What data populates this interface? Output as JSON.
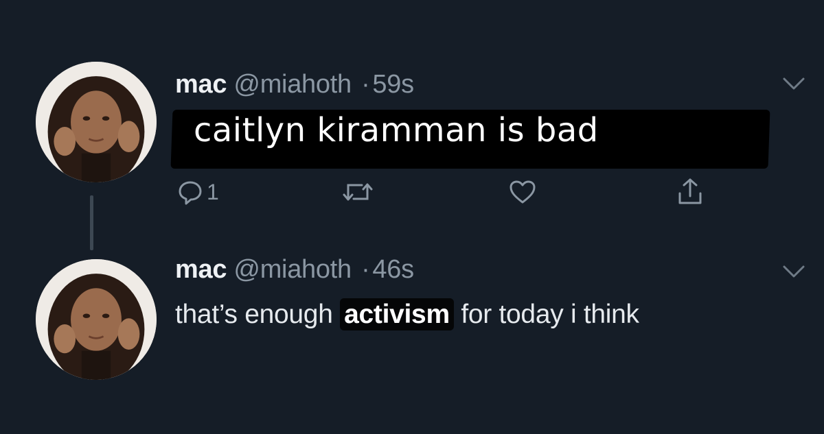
{
  "colors": {
    "background": "#151d27",
    "text": "#e6eaee",
    "muted": "#8b97a3",
    "redaction": "#000000"
  },
  "tweets": [
    {
      "display_name": "mac",
      "handle": "@miahoth",
      "separator": "·",
      "time": "59s",
      "overlay_text": "caitlyn kiramman is bad",
      "reply_count": "1",
      "icons": [
        "reply-icon",
        "retweet-icon",
        "like-icon",
        "share-icon",
        "chevron-down-icon"
      ]
    },
    {
      "display_name": "mac",
      "handle": "@miahoth",
      "separator": "·",
      "time": "46s",
      "text_before": "that’s enough ",
      "text_highlight": "activism",
      "text_after": " for today i think",
      "icons": [
        "chevron-down-icon"
      ]
    }
  ]
}
